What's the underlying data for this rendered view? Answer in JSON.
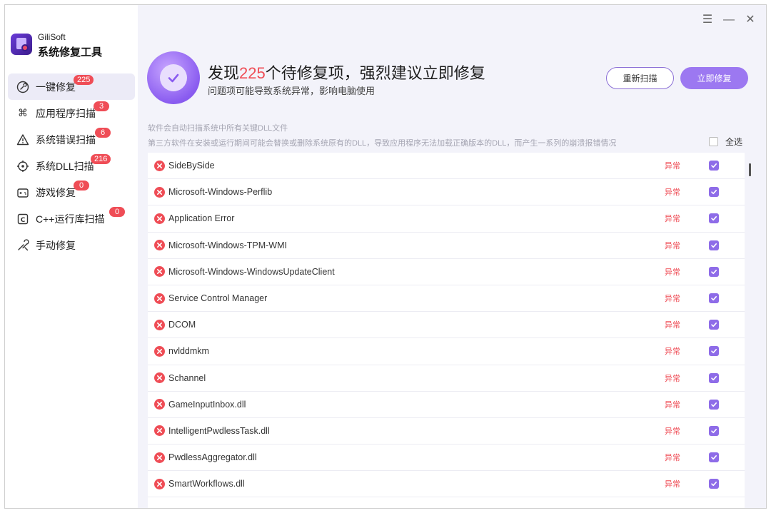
{
  "brand": {
    "small": "GiliSoft",
    "title": "系统修复工具"
  },
  "nav": [
    {
      "label": "一键修复",
      "badge": "225"
    },
    {
      "label": "应用程序扫描",
      "badge": "3"
    },
    {
      "label": "系统错误扫描",
      "badge": "6"
    },
    {
      "label": "系统DLL扫描",
      "badge": "216"
    },
    {
      "label": "游戏修复",
      "badge": "0"
    },
    {
      "label": "C++运行库扫描",
      "badge": "0"
    },
    {
      "label": "手动修复",
      "badge": ""
    }
  ],
  "window_controls": {
    "menu": "☰",
    "minimize": "—",
    "close": "✕"
  },
  "hero": {
    "title_prefix": "发现",
    "count": "225",
    "title_suffix": "个待修复项，强烈建议立即修复",
    "subtitle": "问题项可能导致系统异常，影响电脑使用"
  },
  "buttons": {
    "rescan": "重新扫描",
    "fix": "立即修复"
  },
  "info": {
    "line1": "软件会自动扫描系统中所有关键DLL文件",
    "line2": "第三方软件在安装或运行期间可能会替换或删除系统原有的DLL，导致应用程序无法加载正确版本的DLL，而产生一系列的崩溃报错情况"
  },
  "select_all_label": "全选",
  "items": [
    {
      "name": "SideBySide",
      "status": "异常"
    },
    {
      "name": "Microsoft-Windows-Perflib",
      "status": "异常"
    },
    {
      "name": "Application Error",
      "status": "异常"
    },
    {
      "name": "Microsoft-Windows-TPM-WMI",
      "status": "异常"
    },
    {
      "name": "Microsoft-Windows-WindowsUpdateClient",
      "status": "异常"
    },
    {
      "name": "Service Control Manager",
      "status": "异常"
    },
    {
      "name": "DCOM",
      "status": "异常"
    },
    {
      "name": "nvlddmkm",
      "status": "异常"
    },
    {
      "name": "Schannel",
      "status": "异常"
    },
    {
      "name": "GameInputInbox.dll",
      "status": "异常"
    },
    {
      "name": "IntelligentPwdlessTask.dll",
      "status": "异常"
    },
    {
      "name": "PwdlessAggregator.dll",
      "status": "异常"
    },
    {
      "name": "SmartWorkflows.dll",
      "status": "异常"
    }
  ],
  "colors": {
    "accent": "#9c78f1",
    "error": "#ef4d56",
    "checkbox": "#8e6ce8"
  }
}
